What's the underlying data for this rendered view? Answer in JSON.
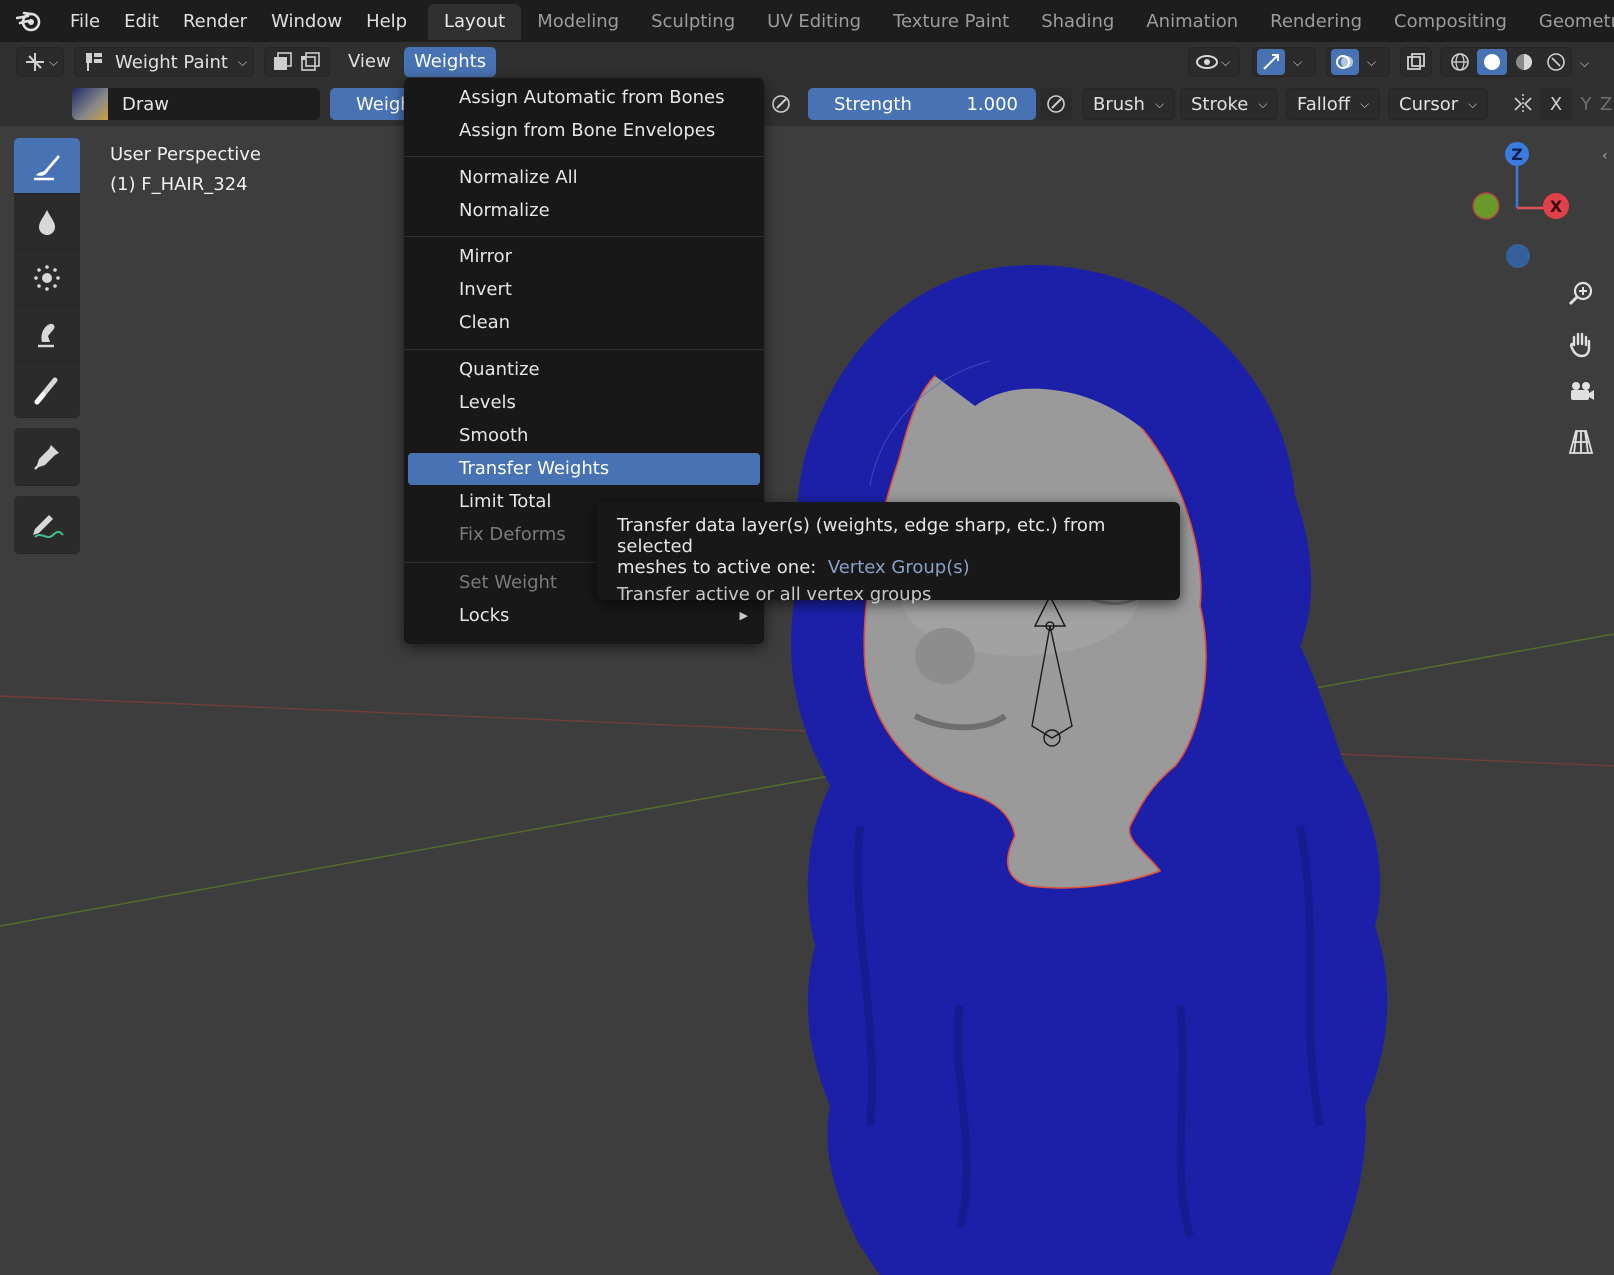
{
  "topbar": {
    "menus": [
      "File",
      "Edit",
      "Render",
      "Window",
      "Help"
    ],
    "workspaces": [
      "Layout",
      "Modeling",
      "Sculpting",
      "UV Editing",
      "Texture Paint",
      "Shading",
      "Animation",
      "Rendering",
      "Compositing",
      "Geometry"
    ],
    "active_workspace": "Layout"
  },
  "header": {
    "mode_label": "Weight Paint",
    "view_label": "View",
    "weights_label": "Weights"
  },
  "toolsettings": {
    "brush_name": "Draw",
    "weight_label_partial": "Weigh",
    "strength_label": "Strength",
    "strength_value": "1.000",
    "brush_dd": "Brush",
    "stroke_dd": "Stroke",
    "falloff_dd": "Falloff",
    "cursor_dd": "Cursor",
    "axis_x": "X",
    "axis_y": "Y",
    "axis_z": "Z"
  },
  "viewport": {
    "view_name": "User Perspective",
    "object_name": "(1) F_HAIR_324",
    "gizmo_z": "Z",
    "gizmo_x": "X"
  },
  "weights_menu": {
    "items": [
      {
        "label": "Assign Automatic from Bones",
        "enabled": true
      },
      {
        "label": "Assign from Bone Envelopes",
        "enabled": true
      },
      {
        "label": "Normalize All",
        "enabled": true
      },
      {
        "label": "Normalize",
        "enabled": true
      },
      {
        "label": "Mirror",
        "enabled": true
      },
      {
        "label": "Invert",
        "enabled": true
      },
      {
        "label": "Clean",
        "enabled": true
      },
      {
        "label": "Quantize",
        "enabled": true
      },
      {
        "label": "Levels",
        "enabled": true
      },
      {
        "label": "Smooth",
        "enabled": true
      },
      {
        "label": "Transfer Weights",
        "enabled": true,
        "highlighted": true
      },
      {
        "label": "Limit Total",
        "enabled": true
      },
      {
        "label": "Fix Deforms",
        "enabled": false
      },
      {
        "label": "Set Weight",
        "enabled": false
      },
      {
        "label": "Locks",
        "enabled": true,
        "submenu": true
      }
    ]
  },
  "tooltip": {
    "line1": "Transfer data layer(s) (weights, edge sharp, etc.) from selected",
    "line2_prefix": "meshes to active one:",
    "line2_python": "Vertex Group(s)",
    "line3": "Transfer active or all vertex groups"
  },
  "colors": {
    "accent": "#4772b3",
    "hair": "#1c20a8",
    "skin": "#9a9a9a",
    "viewport_bg": "#3d3d3d",
    "menu_bg": "#181818"
  }
}
